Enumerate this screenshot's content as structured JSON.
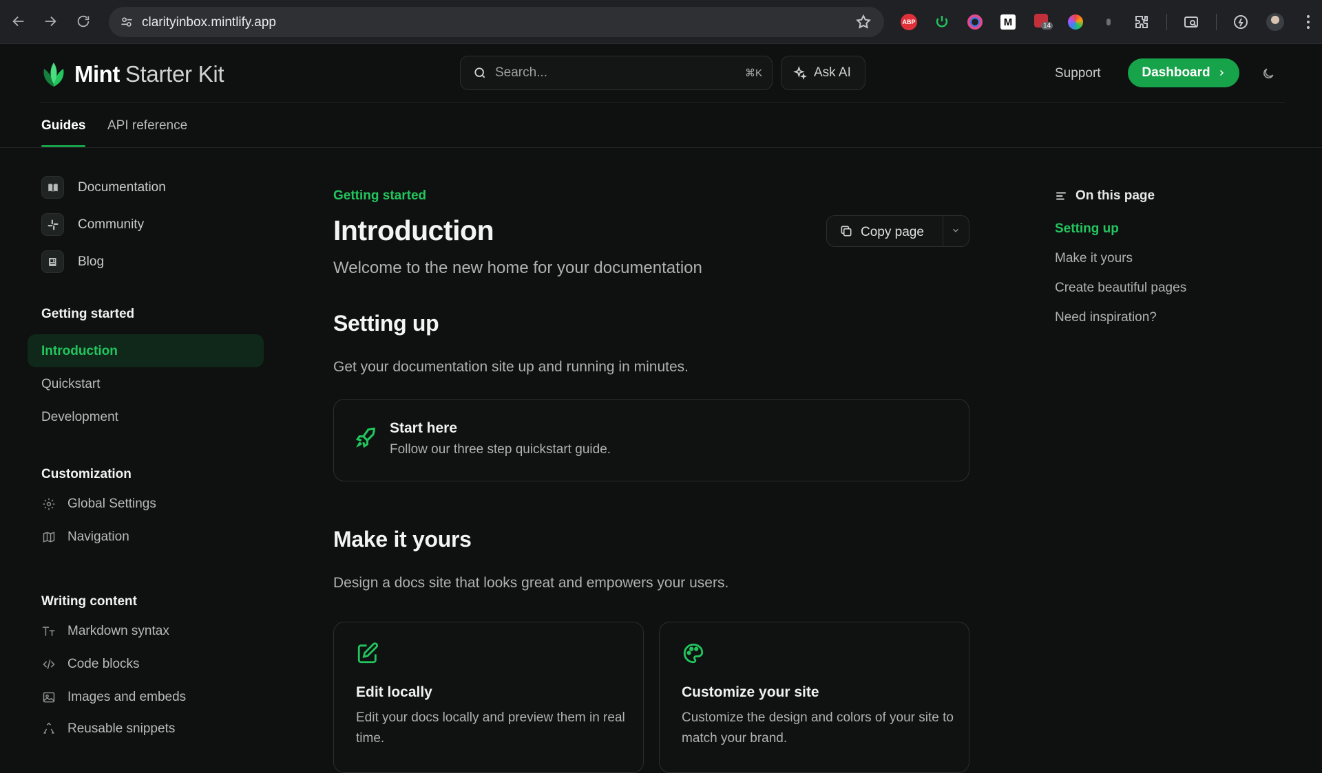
{
  "browser": {
    "url": "clarityinbox.mintlify.app",
    "ext_badge_count": "14",
    "ext_adblock_label": "ABP"
  },
  "header": {
    "brand_name": "Mint",
    "brand_sub": "Starter Kit",
    "search_placeholder": "Search...",
    "search_shortcut": "⌘K",
    "ask_ai_label": "Ask AI",
    "support_label": "Support",
    "dashboard_label": "Dashboard"
  },
  "tabs": [
    {
      "label": "Guides",
      "active": true
    },
    {
      "label": "API reference",
      "active": false
    }
  ],
  "sidebar": {
    "anchors": [
      {
        "label": "Documentation",
        "icon": "book-icon"
      },
      {
        "label": "Community",
        "icon": "slack-icon"
      },
      {
        "label": "Blog",
        "icon": "newspaper-icon"
      }
    ],
    "groups": [
      {
        "title": "Getting started",
        "items": [
          {
            "label": "Introduction",
            "active": true
          },
          {
            "label": "Quickstart"
          },
          {
            "label": "Development"
          }
        ]
      },
      {
        "title": "Customization",
        "items": [
          {
            "label": "Global Settings",
            "icon": "gear-icon"
          },
          {
            "label": "Navigation",
            "icon": "map-icon"
          }
        ]
      },
      {
        "title": "Writing content",
        "items": [
          {
            "label": "Markdown syntax",
            "icon": "text-size-icon"
          },
          {
            "label": "Code blocks",
            "icon": "code-icon"
          },
          {
            "label": "Images and embeds",
            "icon": "image-icon"
          },
          {
            "label": "Reusable snippets",
            "icon": "recycle-icon"
          }
        ]
      }
    ]
  },
  "main": {
    "eyebrow": "Getting started",
    "title": "Introduction",
    "description": "Welcome to the new home for your documentation",
    "copy_page_label": "Copy page",
    "sections": [
      {
        "heading": "Setting up",
        "text": "Get your documentation site up and running in minutes.",
        "cards": [
          {
            "title": "Start here",
            "desc": "Follow our three step quickstart guide.",
            "icon": "rocket-icon"
          }
        ]
      },
      {
        "heading": "Make it yours",
        "text": "Design a docs site that looks great and empowers your users.",
        "cards": [
          {
            "title": "Edit locally",
            "desc": "Edit your docs locally and preview them in real time.",
            "icon": "pencil-square-icon"
          },
          {
            "title": "Customize your site",
            "desc": "Customize the design and colors of your site to match your brand.",
            "icon": "palette-icon"
          }
        ]
      }
    ]
  },
  "toc": {
    "heading": "On this page",
    "items": [
      {
        "label": "Setting up",
        "active": true
      },
      {
        "label": "Make it yours"
      },
      {
        "label": "Create beautiful pages"
      },
      {
        "label": "Need inspiration?"
      }
    ]
  },
  "colors": {
    "accent": "#22c55e",
    "accent_button": "#16a34a",
    "background": "#0f1110"
  }
}
